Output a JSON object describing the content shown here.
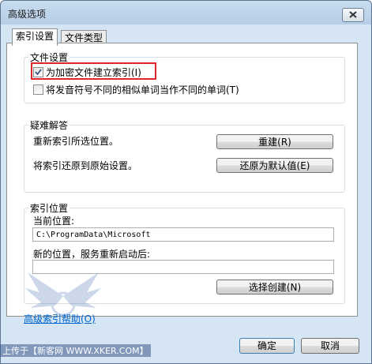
{
  "window": {
    "title": "高级选项"
  },
  "tabs": [
    {
      "label": "索引设置"
    },
    {
      "label": "文件类型"
    }
  ],
  "file_settings": {
    "group_label": "文件设置",
    "encrypt_label": "为加密文件建立索引(I)",
    "encrypt_checked": true,
    "diacritics_label": "将发音符号不同的相似单词当作不同的单词(T)",
    "diacritics_checked": false
  },
  "troubleshooting": {
    "group_label": "疑难解答",
    "rebuild_text": "重新索引所选位置。",
    "rebuild_button": "重建(R)",
    "restore_text": "将索引还原到原始设置。",
    "restore_button": "还原为默认值(E)"
  },
  "index_location": {
    "group_label": "索引位置",
    "current_label": "当前位置:",
    "current_value": "C:\\ProgramData\\Microsoft",
    "new_label": "新的位置，服务重新启动后:",
    "new_value": "",
    "select_button": "选择创建(N)"
  },
  "help_link": "高级索引帮助(O)",
  "footer": {
    "ok": "确定",
    "cancel": "取消"
  },
  "watermark": "上传于【新客网 WWW.XKER.COM】",
  "colors": {
    "highlight": "#e0262b",
    "link": "#0066cc"
  }
}
